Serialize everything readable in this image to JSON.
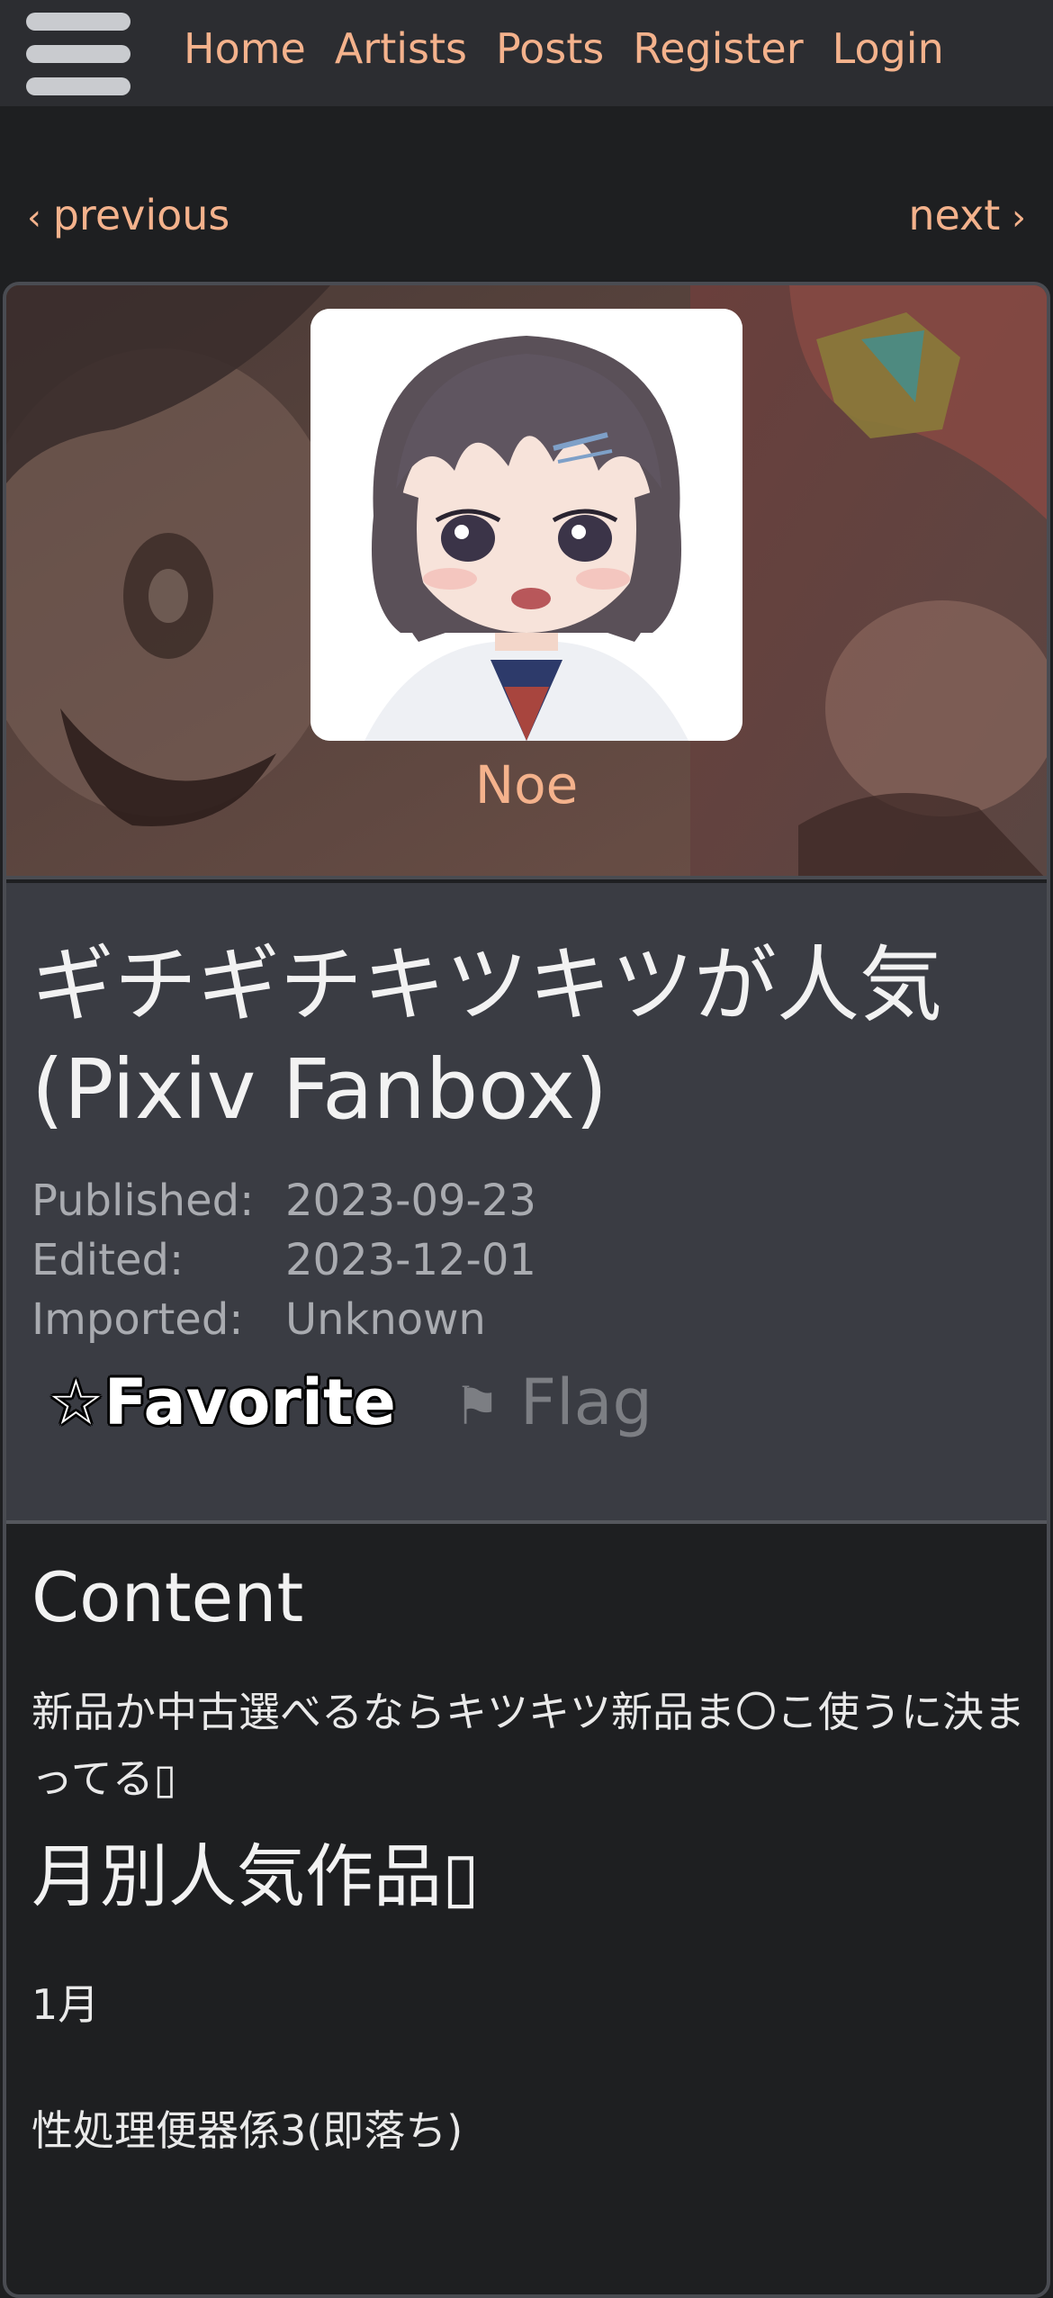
{
  "nav": {
    "links": [
      "Home",
      "Artists",
      "Posts",
      "Register",
      "Login"
    ]
  },
  "pager": {
    "previous": "previous",
    "next": "next"
  },
  "artist": {
    "name": "Noe"
  },
  "post": {
    "title": "ギチギチキツキツが人気 (Pixiv Fanbox)",
    "meta": [
      {
        "label": "Published:",
        "value": "2023-09-23"
      },
      {
        "label": "Edited:",
        "value": "2023-12-01"
      },
      {
        "label": "Imported:",
        "value": "Unknown"
      }
    ],
    "favorite_label": "☆Favorite",
    "flag_label": "Flag"
  },
  "content": {
    "heading": "Content",
    "paragraph": "新品か中古選べるならキツキツ新品ま〇こ使うに決まってる",
    "subheading": "月別人気作品",
    "month": "1月",
    "work": "性処理便器係3(即落ち)"
  },
  "colors": {
    "accent": "#f4b28c",
    "nav_bg": "#2c2d31",
    "page_bg": "#1e1f21",
    "info_bg": "#3a3c43"
  },
  "icons": {
    "menu": "hamburger-menu-icon",
    "flag": "flag-icon",
    "star": "star-outline-icon"
  }
}
